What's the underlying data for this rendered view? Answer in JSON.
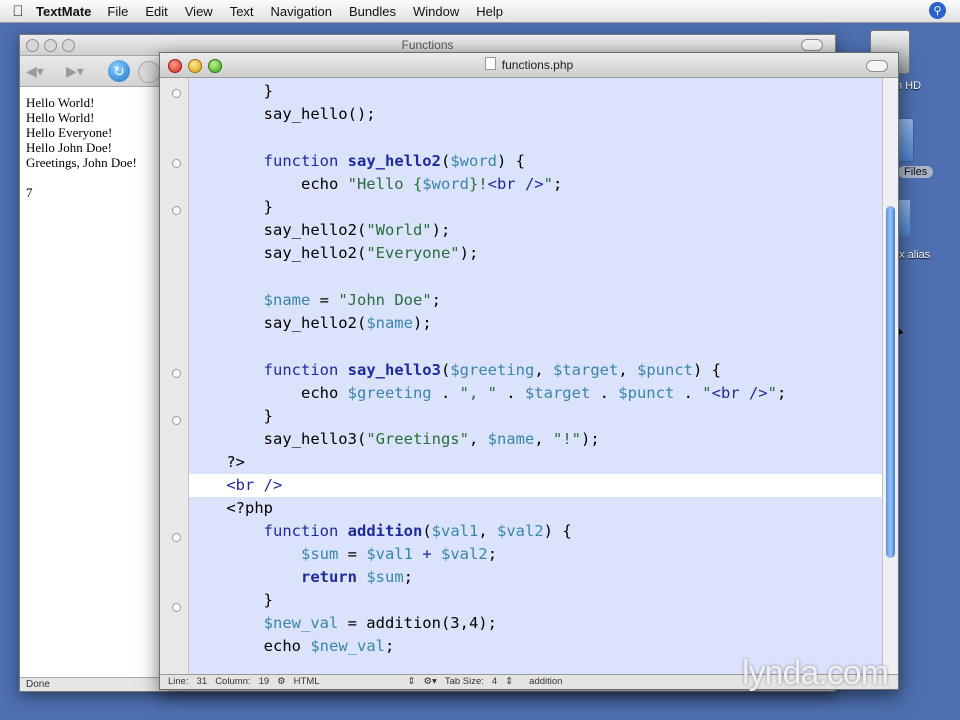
{
  "menubar": {
    "app": "TextMate",
    "items": [
      "File",
      "Edit",
      "View",
      "Text",
      "Navigation",
      "Bundles",
      "Window",
      "Help"
    ]
  },
  "desktop": {
    "hd_label": "h HD",
    "files_label": "Files",
    "alias_label": "ox alias"
  },
  "browser": {
    "title": "Functions",
    "content": [
      "Hello World!",
      "Hello World!",
      "Hello Everyone!",
      "Hello John Doe!",
      "Greetings, John Doe!"
    ],
    "result": "7",
    "status": "Done"
  },
  "editor": {
    "file_name": "functions.php",
    "status": {
      "line_label": "Line:",
      "line": "31",
      "column_label": "Column:",
      "column": "19",
      "language": "HTML",
      "tab_label": "Tab Size:",
      "tab_size": "4",
      "symbol": "addition"
    }
  },
  "watermark": "lynda.com"
}
